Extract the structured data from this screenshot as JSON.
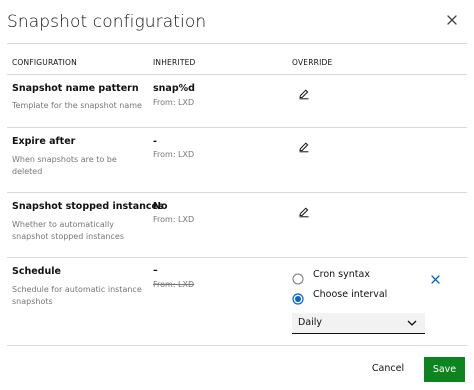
{
  "modal": {
    "title": "Snapshot configuration",
    "close_icon": "close-icon"
  },
  "table": {
    "headers": {
      "configuration": "CONFIGURATION",
      "inherited": "INHERITED",
      "override": "OVERRIDE"
    },
    "rows": [
      {
        "title": "Snapshot name pattern",
        "description": "Template for the snapshot name",
        "inherited_value": "snap%d",
        "inherited_from": "From: LXD",
        "override_icon": "edit-icon"
      },
      {
        "title": "Expire after",
        "description": "When snapshots are to be deleted",
        "inherited_value": "-",
        "inherited_from": "From: LXD",
        "override_icon": "edit-icon"
      },
      {
        "title": "Snapshot stopped instances",
        "description": "Whether to automatically snapshot stopped instances",
        "inherited_value": "No",
        "inherited_from": "From: LXD",
        "override_icon": "edit-icon"
      },
      {
        "title": "Schedule",
        "description": "Schedule for automatic instance snapshots",
        "inherited_value": "–",
        "inherited_from": "From: LXD",
        "override": {
          "options": [
            {
              "label": "Cron syntax",
              "selected": false
            },
            {
              "label": "Choose interval",
              "selected": true
            }
          ],
          "select_value": "Daily",
          "clear_icon": "close-icon"
        }
      }
    ]
  },
  "footer": {
    "cancel_label": "Cancel",
    "save_label": "Save"
  },
  "colors": {
    "accent": "#0066cc",
    "save": "#0e8420",
    "muted": "#777777",
    "divider": "#d9d9d9"
  }
}
